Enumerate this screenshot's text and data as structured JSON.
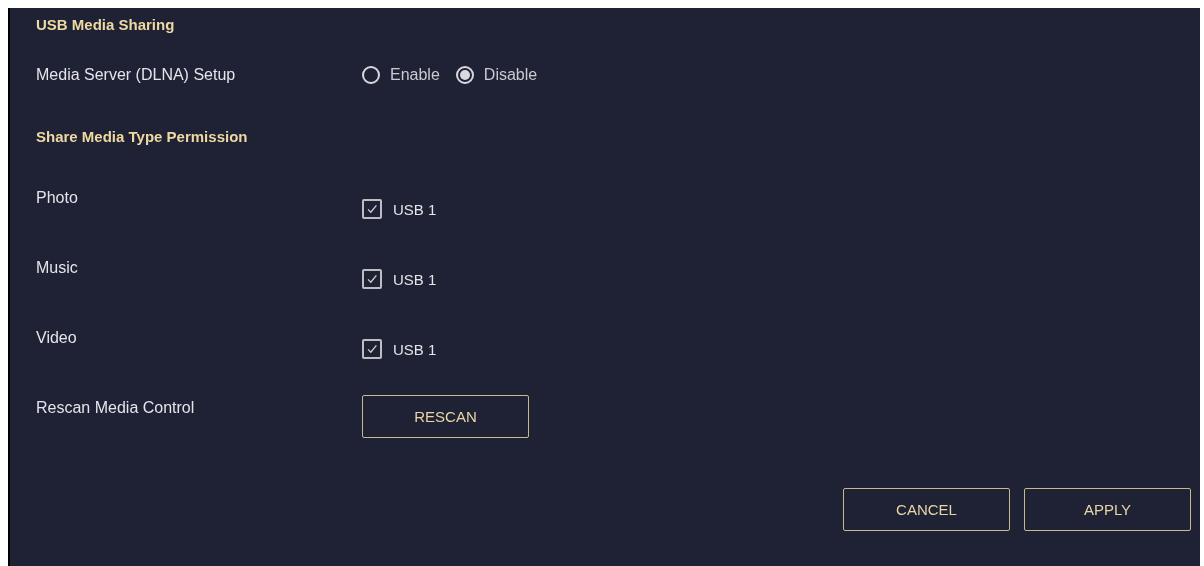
{
  "section_title": "USB Media Sharing",
  "dlna": {
    "label": "Media Server (DLNA) Setup",
    "options": [
      {
        "label": "Enable",
        "selected": false
      },
      {
        "label": "Disable",
        "selected": true
      }
    ]
  },
  "permission_title": "Share Media Type Permission",
  "media_types": [
    {
      "label": "Photo",
      "option": "USB 1",
      "checked": true
    },
    {
      "label": "Music",
      "option": "USB 1",
      "checked": true
    },
    {
      "label": "Video",
      "option": "USB 1",
      "checked": true
    }
  ],
  "rescan": {
    "label": "Rescan Media Control",
    "button": "RESCAN"
  },
  "buttons": [
    "CANCEL",
    "APPLY"
  ]
}
